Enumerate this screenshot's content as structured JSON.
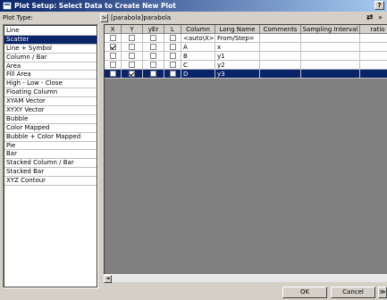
{
  "window": {
    "title": "Plot Setup: Select Data to Create New Plot",
    "help_label": "?"
  },
  "toolbar": {
    "plot_type_label": "Plot Type:",
    "browse_label": ">",
    "source_path": "[parabola]parabola",
    "swap_glyph": "⇄",
    "nav_glyph": "»"
  },
  "plot_types": [
    {
      "label": "Line",
      "selected": false
    },
    {
      "label": "Scatter",
      "selected": true
    },
    {
      "label": "Line + Symbol",
      "selected": false
    },
    {
      "label": "Column / Bar",
      "selected": false
    },
    {
      "label": "Area",
      "selected": false
    },
    {
      "label": "Fill Area",
      "selected": false
    },
    {
      "label": "High - Low - Close",
      "selected": false
    },
    {
      "label": "Floating Column",
      "selected": false
    },
    {
      "label": "XYAM Vector",
      "selected": false
    },
    {
      "label": "XYXY Vector",
      "selected": false
    },
    {
      "label": "Bubble",
      "selected": false
    },
    {
      "label": "Color Mapped",
      "selected": false
    },
    {
      "label": "Bubble + Color Mapped",
      "selected": false
    },
    {
      "label": "Pie",
      "selected": false
    },
    {
      "label": "Bar",
      "selected": false
    },
    {
      "label": "Stacked Column / Bar",
      "selected": false
    },
    {
      "label": "Stacked Bar",
      "selected": false
    },
    {
      "label": "XYZ Contour",
      "selected": false
    }
  ],
  "table": {
    "headers": [
      "X",
      "Y",
      "yEr",
      "L",
      "Column",
      "Long Name",
      "Comments",
      "Sampling Interval",
      "ratio"
    ],
    "rows": [
      {
        "x": false,
        "y": false,
        "yer": false,
        "l": false,
        "column": "<auto\\X>",
        "long_name": "From/Step=",
        "comments": "",
        "sampling": "",
        "selected": false
      },
      {
        "x": true,
        "y": false,
        "yer": false,
        "l": false,
        "column": "A",
        "long_name": "x",
        "comments": "",
        "sampling": "",
        "selected": false
      },
      {
        "x": false,
        "y": false,
        "yer": false,
        "l": false,
        "column": "B",
        "long_name": "y1",
        "comments": "",
        "sampling": "",
        "selected": false
      },
      {
        "x": false,
        "y": false,
        "yer": false,
        "l": false,
        "column": "C",
        "long_name": "y2",
        "comments": "",
        "sampling": "",
        "selected": false
      },
      {
        "x": false,
        "y": true,
        "yer": false,
        "l": false,
        "column": "D",
        "long_name": "y3",
        "comments": "",
        "sampling": "",
        "selected": true
      }
    ]
  },
  "scrollbar": {
    "left_arrow": "◄"
  },
  "buttons": {
    "ok": "OK",
    "cancel": "Cancel",
    "more": "≫"
  }
}
